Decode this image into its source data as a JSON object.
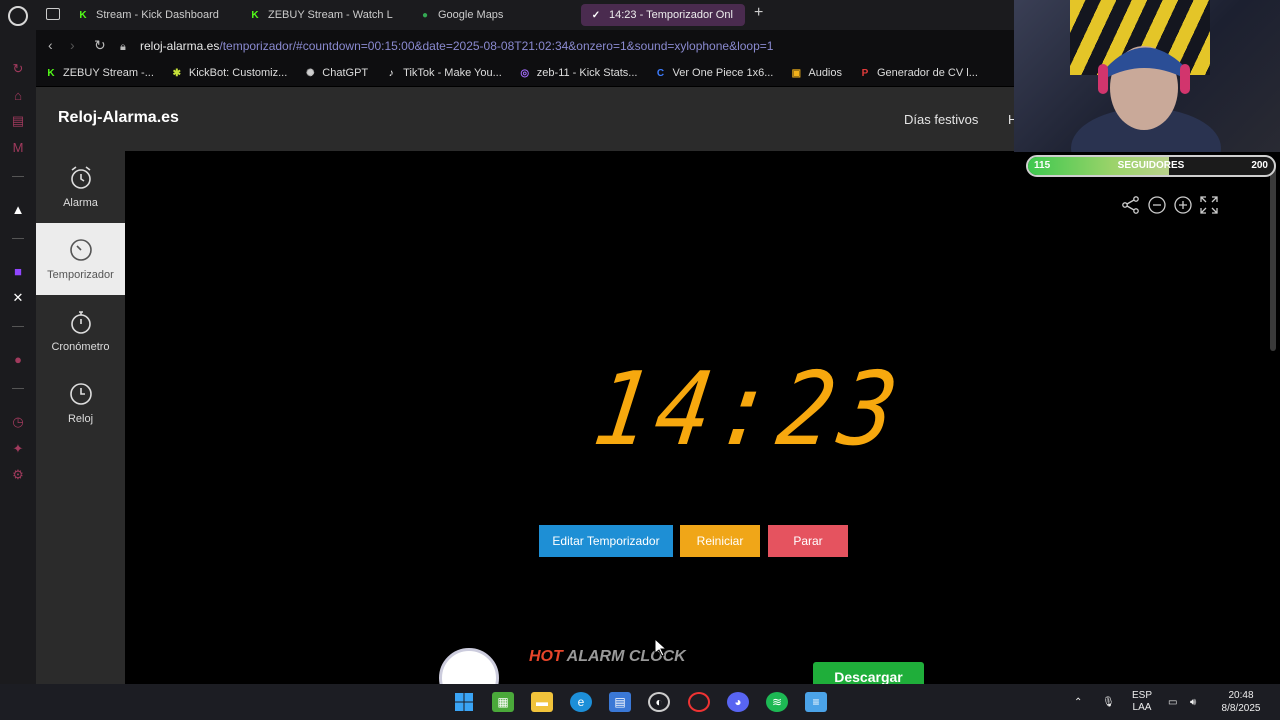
{
  "browser": {
    "tabs": [
      {
        "label": "Stream - Kick Dashboard",
        "fav": "K",
        "color": "#53fc18"
      },
      {
        "label": "ZEBUY Stream - Watch L",
        "fav": "K",
        "color": "#53fc18"
      },
      {
        "label": "Google Maps",
        "fav": "●",
        "color": "#34a853"
      },
      {
        "label": "14:23 - Temporizador Onl",
        "fav": "✓",
        "color": "#ffffff"
      }
    ],
    "new_tab": "+",
    "url_host": "reloj-alarma.es",
    "url_path": "/temporizador/#countdown=00:15:00&date=2025-08-08T21:02:34&onzero=1&sound=xylophone&loop=1",
    "bookmarks": [
      {
        "label": "ZEBUY Stream -...",
        "fav": "K",
        "color": "#53fc18"
      },
      {
        "label": "KickBot: Customiz...",
        "fav": "✱",
        "color": "#c6e23a"
      },
      {
        "label": "ChatGPT",
        "fav": "✺",
        "color": "#cfcfcf"
      },
      {
        "label": "TikTok - Make You...",
        "fav": "♪",
        "color": "#ffffff"
      },
      {
        "label": "zeb-11 - Kick Stats...",
        "fav": "◎",
        "color": "#a56cff"
      },
      {
        "label": "Ver One Piece 1x6...",
        "fav": "C",
        "color": "#3d7cff"
      },
      {
        "label": "Audios",
        "fav": "▣",
        "color": "#f2b21b"
      },
      {
        "label": "Generador de CV l...",
        "fav": "P",
        "color": "#e23b3b"
      }
    ]
  },
  "site": {
    "brand": "Reloj-Alarma.es",
    "header_links": [
      "Días festivos",
      "H"
    ],
    "nav": [
      {
        "label": "Alarma",
        "icon": "alarm-clock-icon"
      },
      {
        "label": "Temporizador",
        "icon": "timer-icon"
      },
      {
        "label": "Cronómetro",
        "icon": "stopwatch-icon"
      },
      {
        "label": "Reloj",
        "icon": "clock-icon"
      }
    ],
    "active_nav": "Temporizador",
    "timer_display": "14:23",
    "buttons": {
      "edit": "Editar Temporizador",
      "reset": "Reiniciar",
      "stop": "Parar"
    },
    "tool_icons": [
      "share-icon",
      "zoom-out-icon",
      "zoom-in-icon",
      "fullscreen-icon"
    ],
    "ad": {
      "title_hot": "HOT",
      "title_rest": " ALARM CLOCK",
      "button": "Descargar"
    }
  },
  "overlay": {
    "followers_current": "115",
    "followers_label": "SEGUIDORES",
    "followers_goal": "200",
    "progress_fraction": 0.575
  },
  "taskbar": {
    "language_top": "ESP",
    "language_bottom": "LAA",
    "time": "20:48",
    "date": "8/8/2025"
  },
  "colors": {
    "clock_digits": "#f7a80e",
    "edit_button": "#1e8fd5",
    "reset_button": "#f0a618",
    "stop_button": "#e5535f",
    "download_button": "#1fae3a"
  }
}
